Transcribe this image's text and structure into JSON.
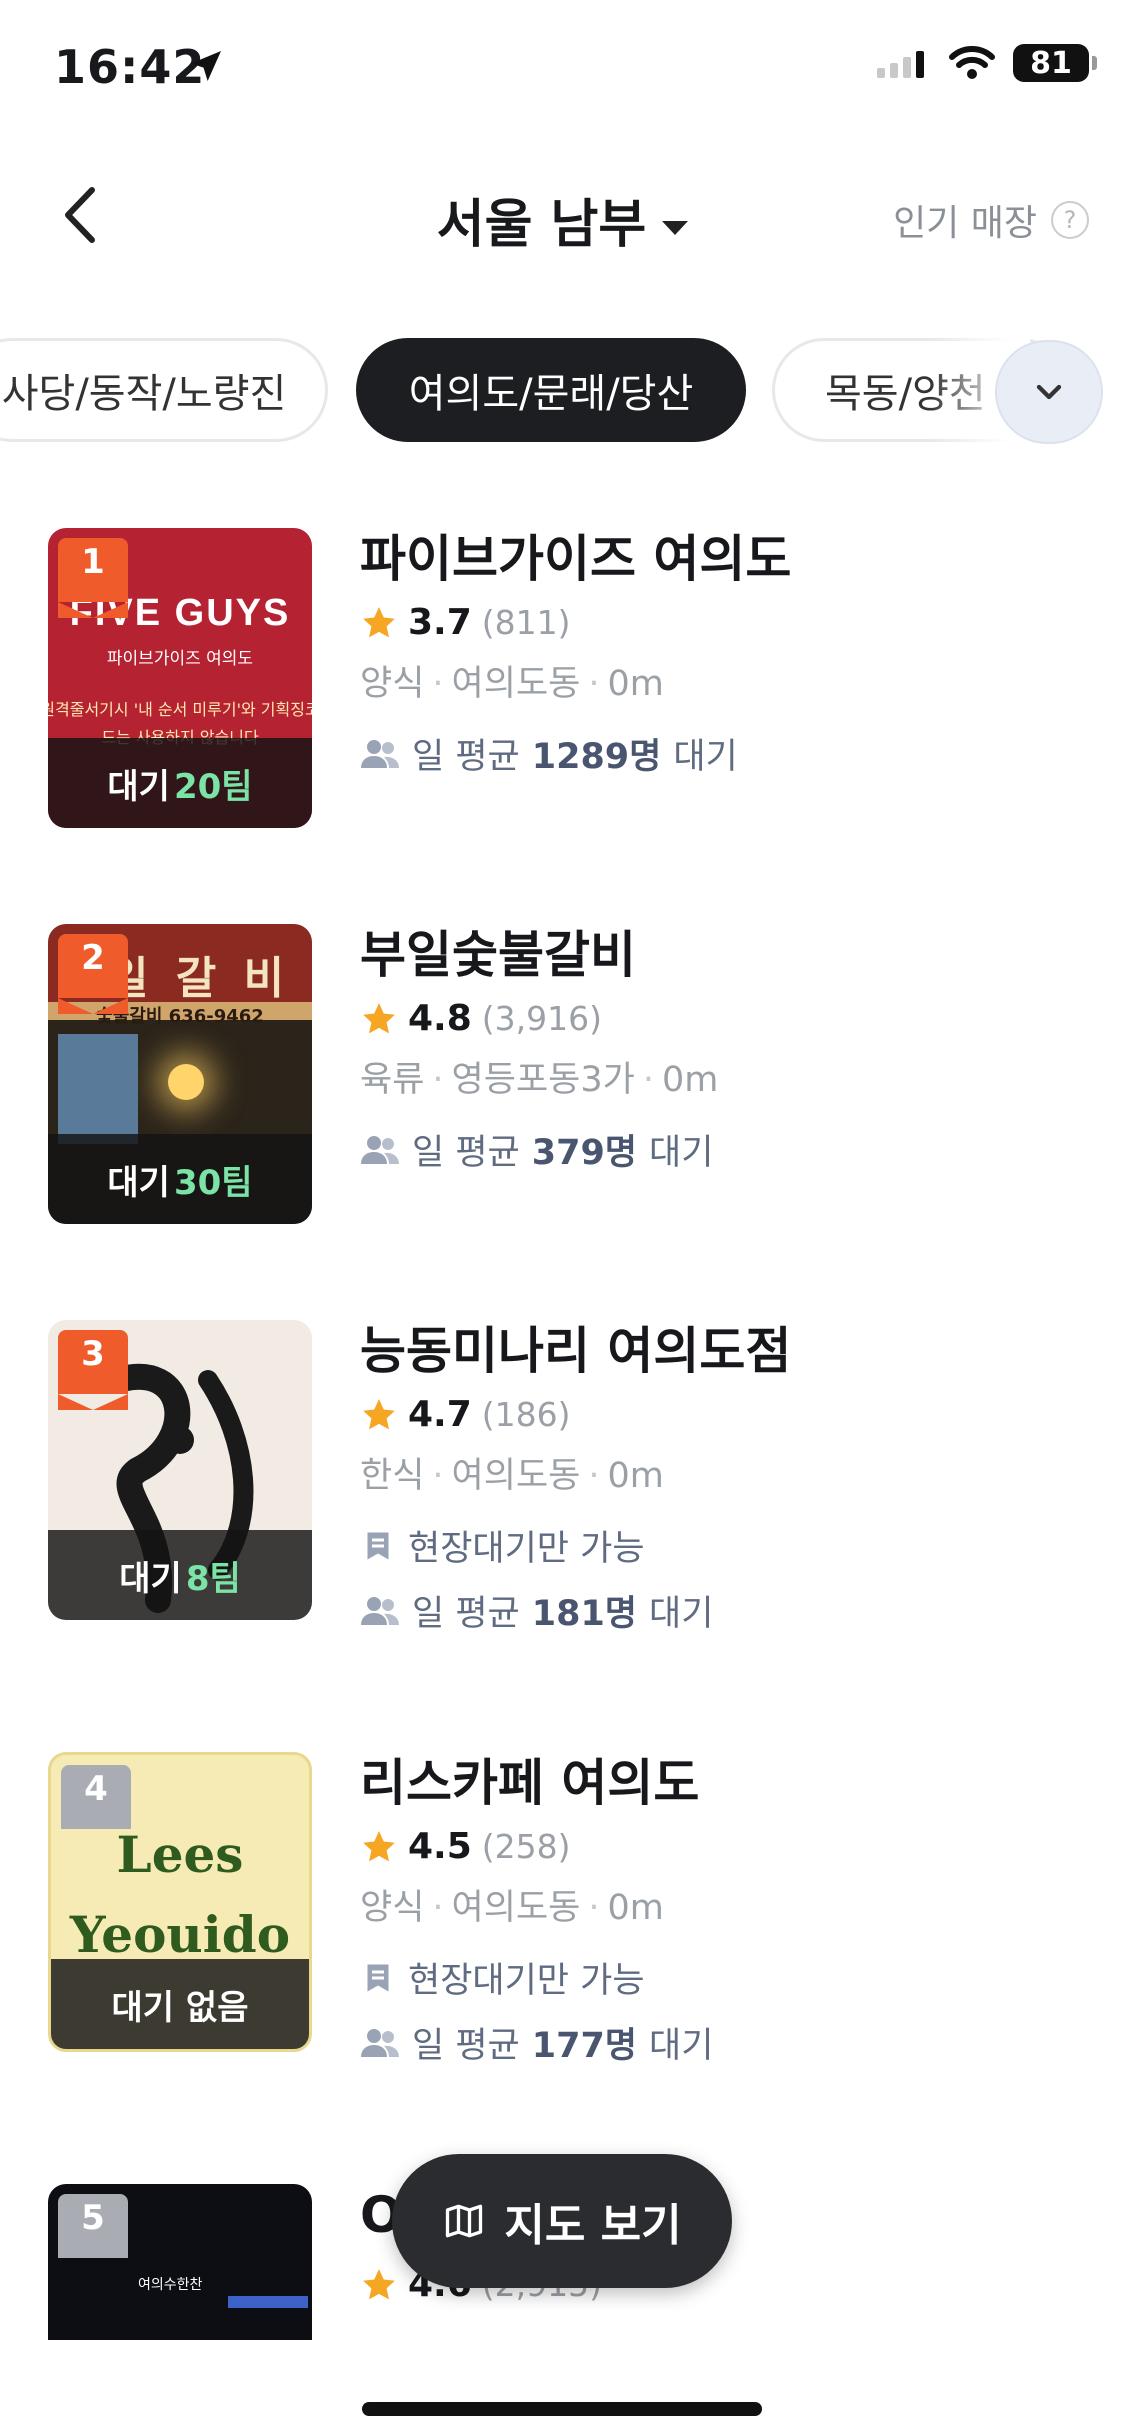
{
  "status_bar": {
    "time": "16:42",
    "battery": "81"
  },
  "header": {
    "title": "서울 남부",
    "popular_label": "인기 매장",
    "help": "?"
  },
  "chips": [
    {
      "label": "사당/동작/노량진",
      "active": false
    },
    {
      "label": "여의도/문래/당산",
      "active": true
    },
    {
      "label": "목동/양천",
      "active": false
    }
  ],
  "items": [
    {
      "rank": "1",
      "name": "파이브가이즈 여의도",
      "rating": "3.7",
      "reviews": "(811)",
      "category": "양식",
      "area": "여의도동",
      "distance": "0m",
      "wait_prefix": "대기",
      "wait_value": "20팀",
      "avg_prefix": "일 평균",
      "avg_value": "1289명",
      "avg_suffix": "대기",
      "thumb": {
        "logo": "FIVE GUYS",
        "sub": "파이브가이즈 여의도",
        "notice": "원격줄서기시 '내 순서 미루기'와 기획징코드는 사용하지 않습니다"
      }
    },
    {
      "rank": "2",
      "name": "부일숯불갈비",
      "rating": "4.8",
      "reviews": "(3,916)",
      "category": "육류",
      "area": "영등포동3가",
      "distance": "0m",
      "wait_prefix": "대기",
      "wait_value": "30팀",
      "avg_prefix": "일 평균",
      "avg_value": "379명",
      "avg_suffix": "대기",
      "thumb": {
        "sign": "일 갈 비",
        "phone": "숯불갈비 636-9462"
      }
    },
    {
      "rank": "3",
      "name": "능동미나리 여의도점",
      "rating": "4.7",
      "reviews": "(186)",
      "category": "한식",
      "area": "여의도동",
      "distance": "0m",
      "wait_prefix": "대기",
      "wait_value": "8팀",
      "onsite": "현장대기만 가능",
      "avg_prefix": "일 평균",
      "avg_value": "181명",
      "avg_suffix": "대기"
    },
    {
      "rank": "4",
      "name": "리스카페 여의도",
      "rating": "4.5",
      "reviews": "(258)",
      "category": "양식",
      "area": "여의도동",
      "distance": "0m",
      "wait_none": "대기 없음",
      "onsite": "현장대기만 가능",
      "avg_prefix": "일 평균",
      "avg_value": "177명",
      "avg_suffix": "대기",
      "thumb": {
        "line1": "Lees",
        "line2": "Yeouido"
      }
    },
    {
      "rank": "5",
      "name_partial": "O",
      "rating": "4.6",
      "reviews": "(2,915)",
      "thumb": {
        "sign": "여의수한찬"
      }
    }
  ],
  "map_button": {
    "label": "지도 보기"
  },
  "colors": {
    "accent_orange": "#ef5b2a",
    "wait_green": "#7be3a6",
    "star": "#f5a623",
    "chip_active": "#1c1e22"
  }
}
